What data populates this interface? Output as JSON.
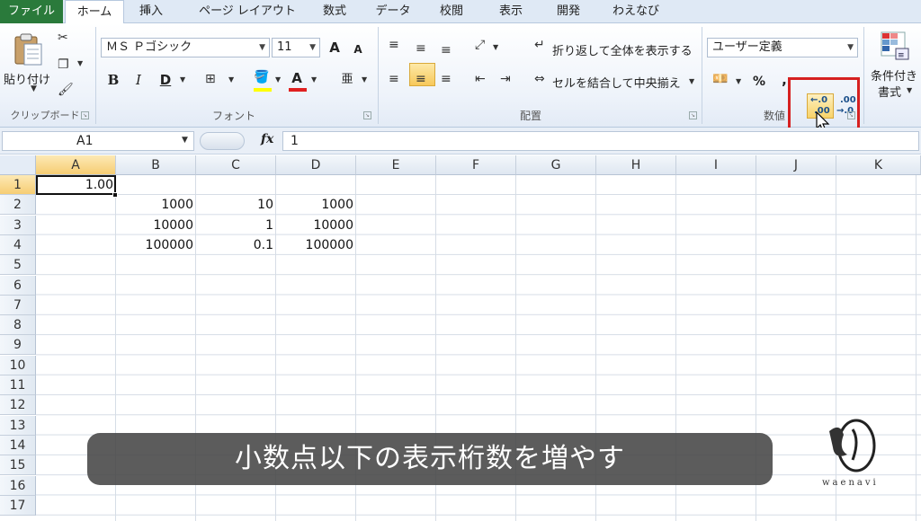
{
  "tabs": [
    "ファイル",
    "ホーム",
    "挿入",
    "ページ レイアウト",
    "数式",
    "データ",
    "校閲",
    "表示",
    "開発",
    "わえなび"
  ],
  "ribbon": {
    "clipboard": {
      "paste": "貼り付け",
      "group": "クリップボード"
    },
    "font": {
      "name": "ＭＳ Ｐゴシック",
      "size": "11",
      "group": "フォント",
      "bold": "B",
      "italic": "I",
      "underline": "D",
      "grow": "A",
      "shrink": "A",
      "font_color": "A",
      "phonetic": "亜"
    },
    "alignment": {
      "wrap": "折り返して全体を表示する",
      "merge": "セルを結合して中央揃え",
      "group": "配置"
    },
    "number": {
      "format": "ユーザー定義",
      "percent": "%",
      "comma": ",",
      "group": "数値",
      "increase_decimal": {
        "top": "←.0",
        "bottom": ".00"
      },
      "decrease_decimal": {
        "top": ".00",
        "bottom": "→.0"
      }
    },
    "styles": {
      "conditional_line1": "条件付き",
      "conditional_line2": "書式"
    }
  },
  "formula_bar": {
    "name_box": "A1",
    "fx": "fx",
    "value": "1"
  },
  "columns": [
    "A",
    "B",
    "C",
    "D",
    "E",
    "F",
    "G",
    "H",
    "I",
    "J",
    "K"
  ],
  "rows": [
    "1",
    "2",
    "3",
    "4",
    "5",
    "6",
    "7",
    "8",
    "9",
    "10",
    "11",
    "12",
    "13",
    "14",
    "15",
    "16",
    "17"
  ],
  "cells": {
    "A1": "1.00",
    "B2": "1000",
    "C2": "10",
    "D2": "1000",
    "B3": "10000",
    "C3": "1",
    "D3": "10000",
    "B4": "100000",
    "C4": "0.1",
    "D4": "100000"
  },
  "caption": "小数点以下の表示桁数を増やす",
  "logo_text": "waenavi",
  "colors": {
    "file_tab": "#2a7a3b",
    "highlight": "#d62020",
    "caption_bg": "#464646"
  }
}
